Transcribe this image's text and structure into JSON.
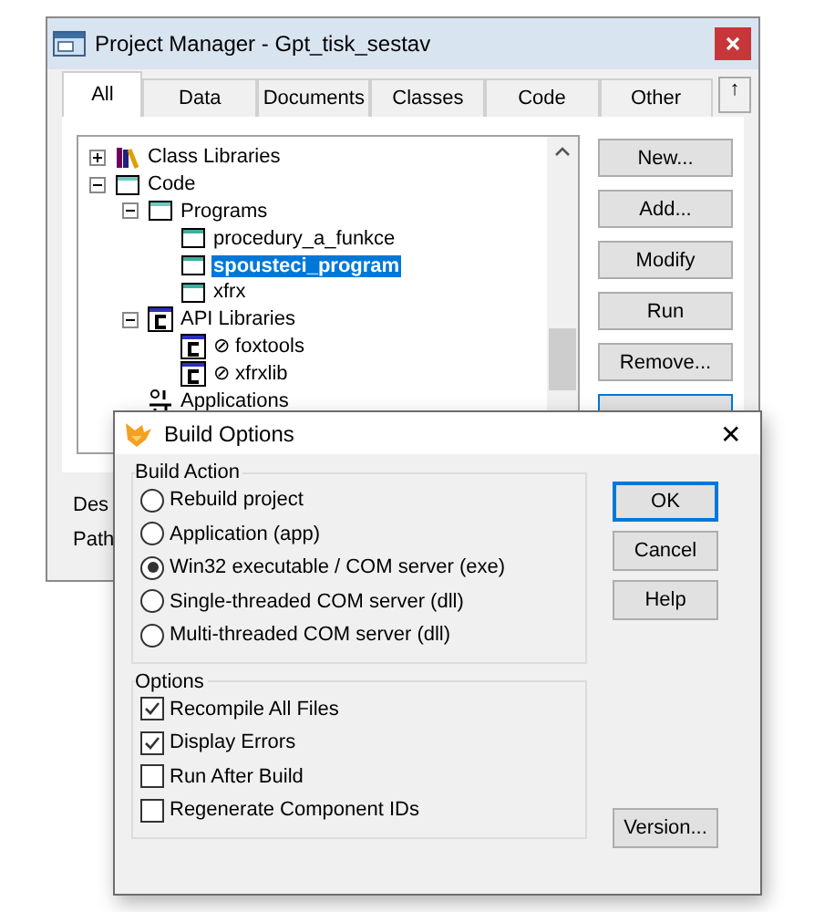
{
  "project_window": {
    "title": "Project Manager - Gpt_tisk_sestav",
    "tabs": [
      {
        "label": "All",
        "selected": true
      },
      {
        "label": "Data",
        "selected": false
      },
      {
        "label": "Documents",
        "selected": false
      },
      {
        "label": "Classes",
        "selected": false
      },
      {
        "label": "Code",
        "selected": false
      },
      {
        "label": "Other",
        "selected": false
      }
    ],
    "collapse_button": "↑",
    "tree": [
      {
        "label": "Class Libraries",
        "kind": "library",
        "expanded": false,
        "selected": false
      },
      {
        "label": "Code",
        "kind": "folder",
        "expanded": true,
        "selected": false,
        "children": [
          {
            "label": "Programs",
            "kind": "folder",
            "expanded": true,
            "selected": false,
            "children": [
              {
                "label": "procedury_a_funkce",
                "kind": "program",
                "selected": false
              },
              {
                "label": "spousteci_program",
                "kind": "program",
                "selected": true
              },
              {
                "label": "xfrx",
                "kind": "program",
                "selected": false
              }
            ]
          },
          {
            "label": "API Libraries",
            "kind": "api",
            "expanded": true,
            "selected": false,
            "children": [
              {
                "label": "⊘ foxtools",
                "kind": "api",
                "selected": false
              },
              {
                "label": "⊘ xfrxlib",
                "kind": "api",
                "selected": false
              }
            ]
          },
          {
            "label": "Applications",
            "kind": "app",
            "selected": false
          }
        ]
      }
    ],
    "buttons": [
      "New...",
      "Add...",
      "Modify",
      "Run",
      "Remove..."
    ],
    "footer_labels": [
      "Des",
      "Path"
    ]
  },
  "dialog": {
    "title": "Build Options",
    "build_action": {
      "title": "Build Action",
      "options": [
        {
          "label": "Rebuild project",
          "selected": false
        },
        {
          "label": "Application (app)",
          "selected": false
        },
        {
          "label": "Win32 executable / COM server (exe)",
          "selected": true
        },
        {
          "label": "Single-threaded COM server (dll)",
          "selected": false
        },
        {
          "label": "Multi-threaded COM server (dll)",
          "selected": false
        }
      ]
    },
    "options": {
      "title": "Options",
      "items": [
        {
          "label": "Recompile All Files",
          "checked": true
        },
        {
          "label": "Display Errors",
          "checked": true
        },
        {
          "label": "Run After Build",
          "checked": false
        },
        {
          "label": "Regenerate Component IDs",
          "checked": false
        }
      ]
    },
    "buttons": [
      "OK",
      "Cancel",
      "Help"
    ],
    "version_button": "Version...",
    "close": "✕"
  }
}
